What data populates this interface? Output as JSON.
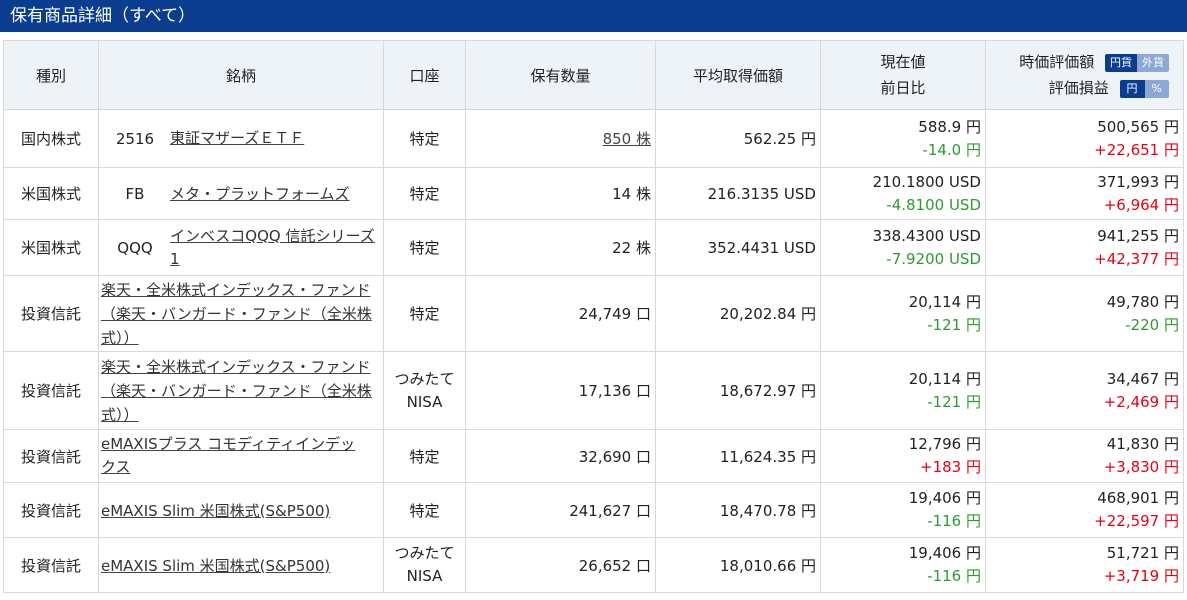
{
  "title": "保有商品詳細（すべて）",
  "headers": {
    "type": "種別",
    "name": "銘柄",
    "account": "口座",
    "quantity": "保有数量",
    "avg_cost": "平均取得価額",
    "price_line1": "現在値",
    "price_line2": "前日比",
    "eval_line1": "時価評価額",
    "eval_line2": "評価損益",
    "toggle1": [
      "円貨",
      "外貨"
    ],
    "toggle2": [
      "円",
      "%"
    ]
  },
  "rows": [
    {
      "type": "国内株式",
      "code": "2516",
      "name": "東証マザーズＥＴＦ",
      "account": "特定",
      "quantity": "850 株",
      "avg_cost": "562.25 円",
      "price": "588.9 円",
      "change": "-14.0 円",
      "eval": "500,565 円",
      "pl": "+22,651 円"
    },
    {
      "type": "米国株式",
      "code": "FB",
      "name": "メタ・プラットフォームズ",
      "account": "特定",
      "quantity": "14 株",
      "avg_cost": "216.3135 USD",
      "price": "210.1800 USD",
      "change": "-4.8100 USD",
      "eval": "371,993 円",
      "pl": "+6,964 円"
    },
    {
      "type": "米国株式",
      "code": "QQQ",
      "name": "インベスコQQQ 信託シリーズ1",
      "account": "特定",
      "quantity": "22 株",
      "avg_cost": "352.4431 USD",
      "price": "338.4300 USD",
      "change": "-7.9200 USD",
      "eval": "941,255 円",
      "pl": "+42,377 円"
    },
    {
      "type": "投資信託",
      "code": "",
      "name": "楽天・全米株式インデックス・ファンド（楽天・バンガード・ファンド（全米株式））",
      "account": "特定",
      "quantity": "24,749 口",
      "avg_cost": "20,202.84 円",
      "price": "20,114 円",
      "change": "-121 円",
      "eval": "49,780 円",
      "pl": "-220 円"
    },
    {
      "type": "投資信託",
      "code": "",
      "name": "楽天・全米株式インデックス・ファンド（楽天・バンガード・ファンド（全米株式））",
      "account": "つみたてNISA",
      "quantity": "17,136 口",
      "avg_cost": "18,672.97 円",
      "price": "20,114 円",
      "change": "-121 円",
      "eval": "34,467 円",
      "pl": "+2,469 円"
    },
    {
      "type": "投資信託",
      "code": "",
      "name": "eMAXISプラス コモディティインデックス",
      "account": "特定",
      "quantity": "32,690 口",
      "avg_cost": "11,624.35 円",
      "price": "12,796 円",
      "change": "+183 円",
      "eval": "41,830 円",
      "pl": "+3,830 円"
    },
    {
      "type": "投資信託",
      "code": "",
      "name": "eMAXIS Slim 米国株式(S&P500)",
      "account": "特定",
      "quantity": "241,627 口",
      "avg_cost": "18,470.78 円",
      "price": "19,406 円",
      "change": "-116 円",
      "eval": "468,901 円",
      "pl": "+22,597 円"
    },
    {
      "type": "投資信託",
      "code": "",
      "name": "eMAXIS Slim 米国株式(S&P500)",
      "account": "つみたてNISA",
      "quantity": "26,652 口",
      "avg_cost": "18,010.66 円",
      "price": "19,406 円",
      "change": "-116 円",
      "eval": "51,721 円",
      "pl": "+3,719 円"
    }
  ]
}
